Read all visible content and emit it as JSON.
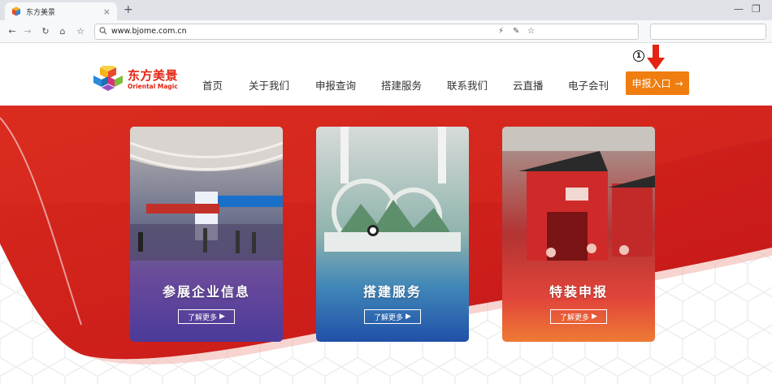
{
  "browser": {
    "tab_title": "东方美景",
    "url": "www.bjome.com.cn"
  },
  "site": {
    "brand_cn": "东方美景",
    "brand_en": "Oriental Magic",
    "nav": [
      "首页",
      "关于我们",
      "申报查询",
      "搭建服务",
      "联系我们",
      "云直播",
      "电子会刊"
    ],
    "cta_label": "申报入口",
    "cta_arrow": "→",
    "annotation": "1"
  },
  "cards": [
    {
      "title": "参展企业信息",
      "button": "了解更多"
    },
    {
      "title": "搭建服务",
      "button": "了解更多"
    },
    {
      "title": "特装申报",
      "button": "了解更多"
    }
  ],
  "colors": {
    "brand_red": "#e42312",
    "cta_orange": "#ef7d10"
  }
}
